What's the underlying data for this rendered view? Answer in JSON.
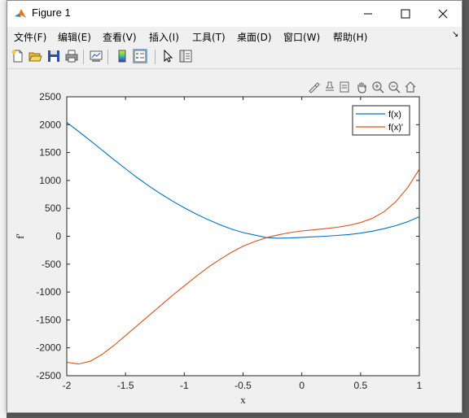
{
  "window": {
    "title": "Figure 1"
  },
  "menu": {
    "items": [
      {
        "label": "文件(F)"
      },
      {
        "label": "编辑(E)"
      },
      {
        "label": "查看(V)"
      },
      {
        "label": "插入(I)"
      },
      {
        "label": "工具(T)"
      },
      {
        "label": "桌面(D)"
      },
      {
        "label": "窗口(W)"
      },
      {
        "label": "帮助(H)"
      }
    ]
  },
  "toolbar": {
    "icons": [
      "new-figure-icon",
      "open-file-icon",
      "save-icon",
      "print-icon",
      "link-plot-icon",
      "colorbar-icon",
      "legend-icon",
      "edit-plot-icon",
      "property-inspector-icon"
    ]
  },
  "axes_toolbar": {
    "icons": [
      "brush-icon",
      "data-tips-icon",
      "pan-icon",
      "zoom-in-icon",
      "zoom-out-icon",
      "restore-view-icon"
    ]
  },
  "colors": {
    "series1": "#0072BD",
    "series2": "#D95319"
  },
  "chart_data": {
    "type": "line",
    "xlabel": "x",
    "ylabel": "f'",
    "xlim": [
      -2,
      1
    ],
    "ylim": [
      -2500,
      2500
    ],
    "xticks": [
      "-2",
      "-1.5",
      "-1",
      "-0.5",
      "0",
      "0.5",
      "1"
    ],
    "yticks": [
      "-2500",
      "-2000",
      "-1500",
      "-1000",
      "-500",
      "0",
      "500",
      "1000",
      "1500",
      "2000",
      "2500"
    ],
    "grid": false,
    "legend_position": "top-right",
    "series": [
      {
        "name": "f(x)",
        "x": [
          -2,
          -1.9,
          -1.8,
          -1.7,
          -1.6,
          -1.5,
          -1.4,
          -1.3,
          -1.2,
          -1.1,
          -1.0,
          -0.9,
          -0.8,
          -0.7,
          -0.6,
          -0.5,
          -0.4,
          -0.3,
          -0.2,
          -0.1,
          0,
          0.1,
          0.2,
          0.3,
          0.4,
          0.5,
          0.6,
          0.7,
          0.8,
          0.9,
          1.0
        ],
        "y": [
          2040,
          1880,
          1715,
          1545,
          1375,
          1210,
          1050,
          900,
          760,
          630,
          510,
          400,
          300,
          210,
          130,
          65,
          20,
          -25,
          -35,
          -30,
          -20,
          -10,
          0,
          15,
          30,
          55,
          90,
          135,
          190,
          260,
          350
        ]
      },
      {
        "name": "f(x)'",
        "x": [
          -2,
          -1.9,
          -1.8,
          -1.7,
          -1.6,
          -1.5,
          -1.4,
          -1.3,
          -1.2,
          -1.1,
          -1.0,
          -0.9,
          -0.8,
          -0.7,
          -0.6,
          -0.5,
          -0.4,
          -0.3,
          -0.2,
          -0.1,
          0,
          0.1,
          0.2,
          0.3,
          0.4,
          0.5,
          0.6,
          0.7,
          0.8,
          0.9,
          1.0
        ],
        "y": [
          -2260,
          -2290,
          -2240,
          -2120,
          -1960,
          -1780,
          -1600,
          -1420,
          -1240,
          -1060,
          -890,
          -720,
          -560,
          -420,
          -290,
          -180,
          -95,
          -25,
          25,
          65,
          95,
          115,
          135,
          160,
          195,
          245,
          320,
          440,
          620,
          870,
          1200
        ]
      }
    ]
  }
}
